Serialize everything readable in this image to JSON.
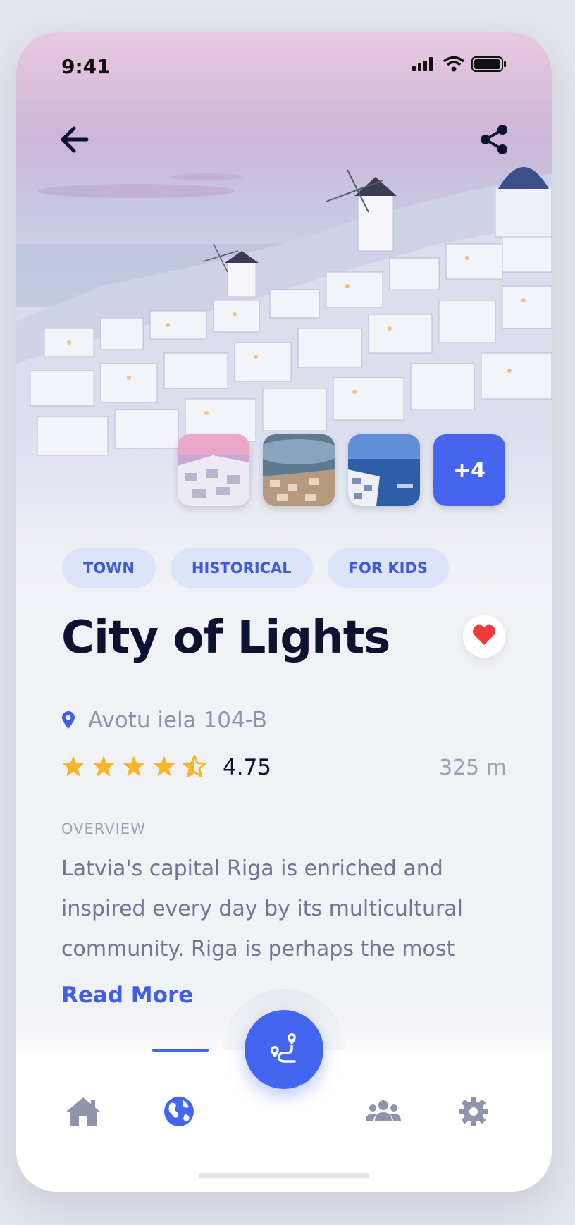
{
  "status_bar": {
    "time": "9:41",
    "icons": [
      "signal-icon",
      "wifi-icon",
      "battery-icon"
    ]
  },
  "header": {
    "back_icon": "arrow-left-icon",
    "share_icon": "share-icon"
  },
  "gallery": {
    "thumbnails": [
      "photo-sunset",
      "photo-harbor",
      "photo-sea"
    ],
    "more_label": "+4"
  },
  "tags": [
    "TOWN",
    "HISTORICAL",
    "FOR KIDS"
  ],
  "place": {
    "title": "City of Lights",
    "address": "Avotu iela 104-B",
    "rating_value": "4.75",
    "rating_stars": 4.5,
    "distance": "325 m",
    "favorite": true
  },
  "overview": {
    "label": "OVERVIEW",
    "text": "Latvia's capital Riga is enriched and inspired every day by its multicultural community. Riga is perhaps the most",
    "read_more": "Read More"
  },
  "bottom_nav": {
    "items": [
      "home-icon",
      "globe-icon",
      "route-icon",
      "users-icon",
      "gear-icon"
    ],
    "active": "globe-icon"
  },
  "colors": {
    "accent": "#4266f0",
    "title": "#0d1231",
    "muted": "#8d93ad",
    "star": "#f7b52c",
    "heart": "#ef3b3b"
  }
}
